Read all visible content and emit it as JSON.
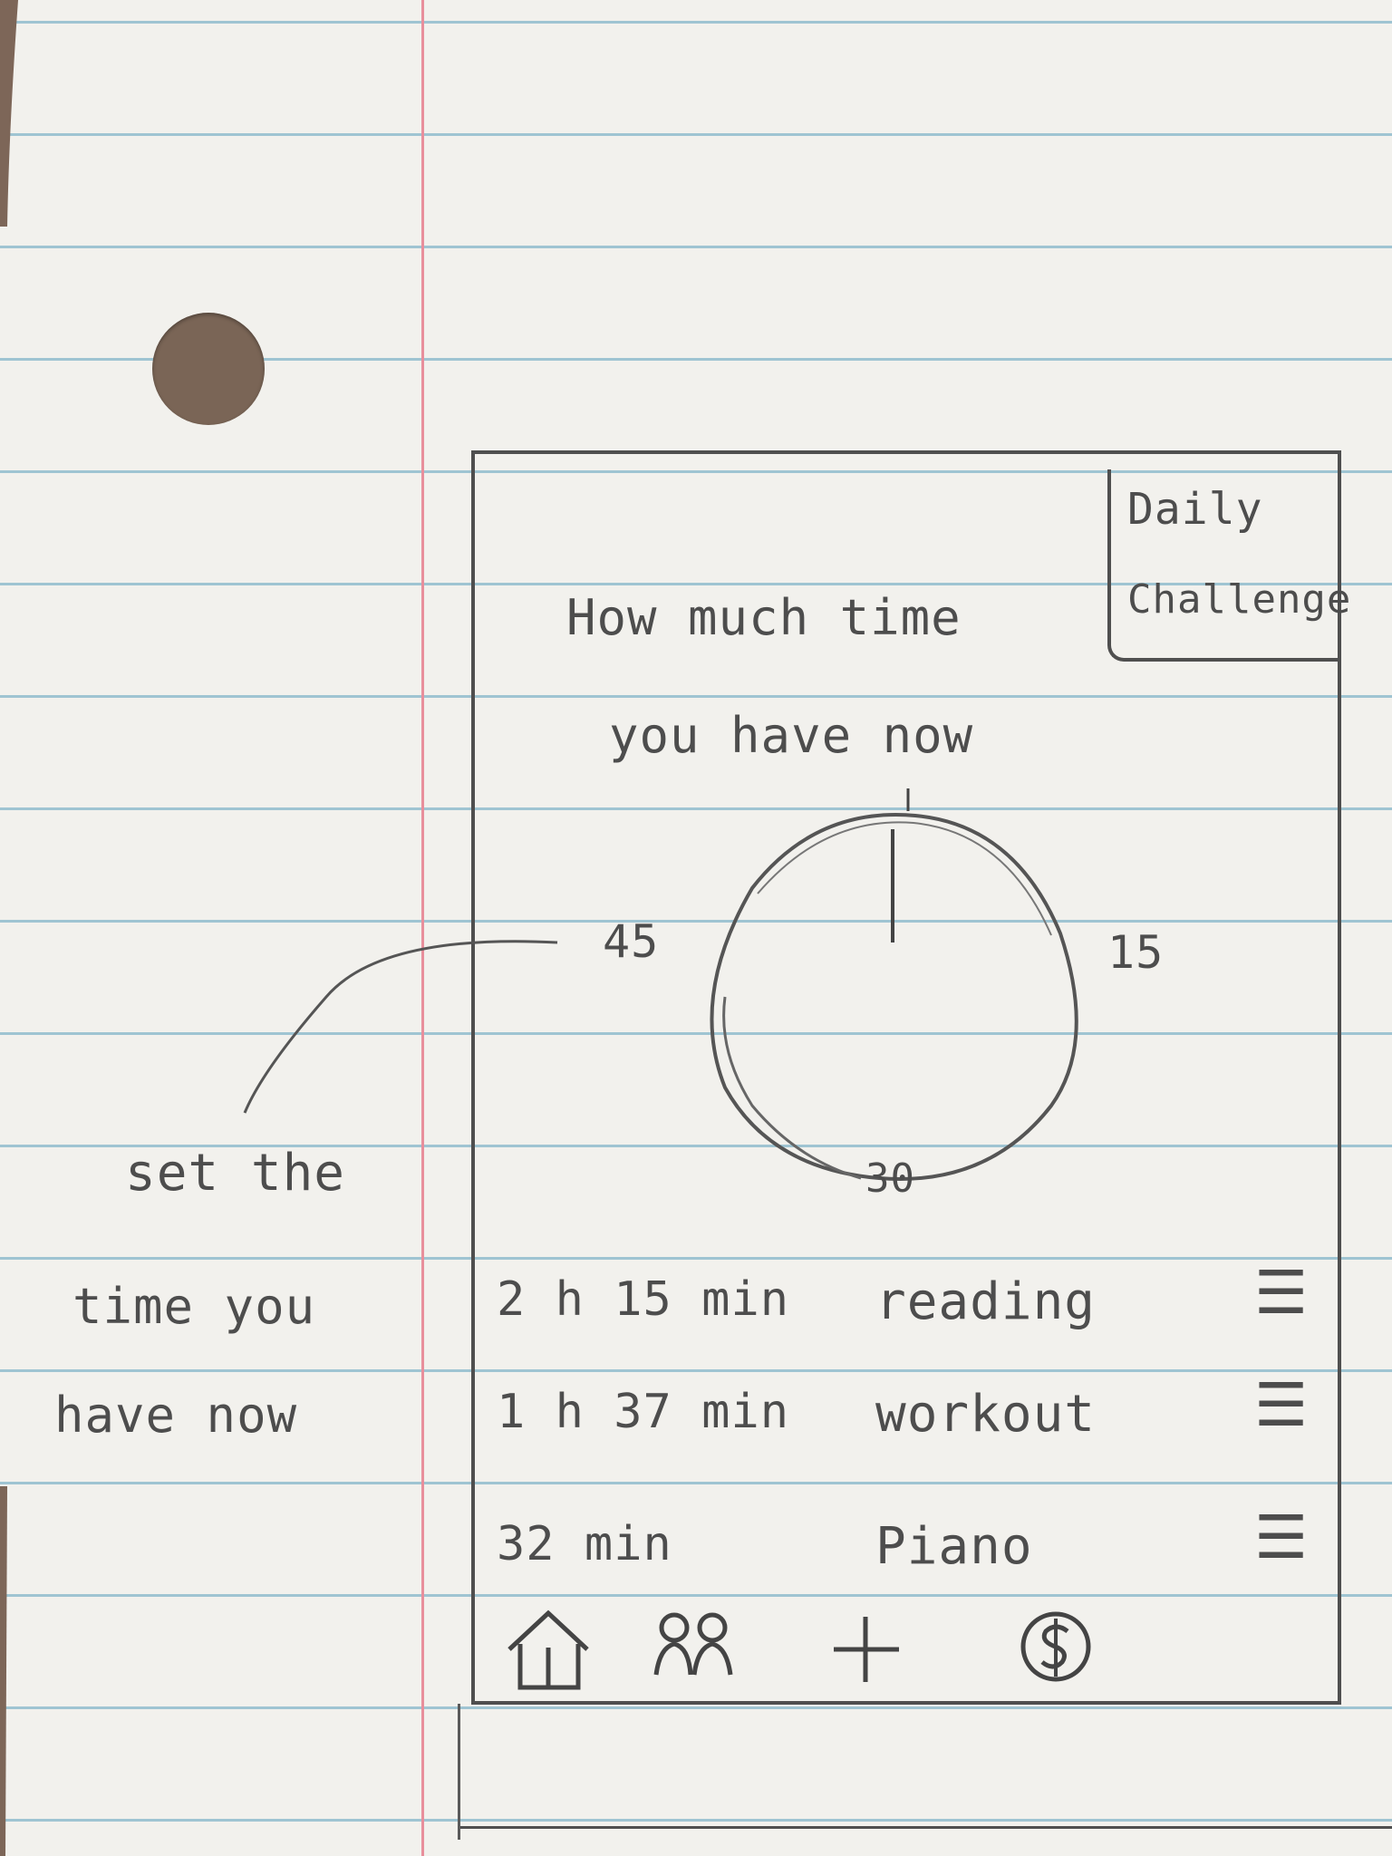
{
  "sketch": {
    "header": {
      "daily_challenge_line1": "Daily",
      "daily_challenge_line2": "Challenge",
      "question_line1": "How much time",
      "question_line2": "you have now"
    },
    "timer": {
      "labels": {
        "quarter": "15",
        "half": "30",
        "three_quarter": "45"
      }
    },
    "annotation": {
      "line1": "set the",
      "line2": "time you",
      "line3": "have now"
    },
    "activities": [
      {
        "duration": "2 h 15 min",
        "name": "reading",
        "handle_icon": "drag-handle-icon"
      },
      {
        "duration": "1 h 37 min",
        "name": "workout",
        "handle_icon": "drag-handle-icon"
      },
      {
        "duration": "32 min",
        "name": "Piano",
        "handle_icon": "drag-handle-icon"
      }
    ],
    "tabbar": {
      "items": [
        {
          "icon": "home-icon"
        },
        {
          "icon": "people-icon"
        },
        {
          "icon": "add-icon"
        },
        {
          "icon": "dollar-icon"
        }
      ]
    }
  }
}
